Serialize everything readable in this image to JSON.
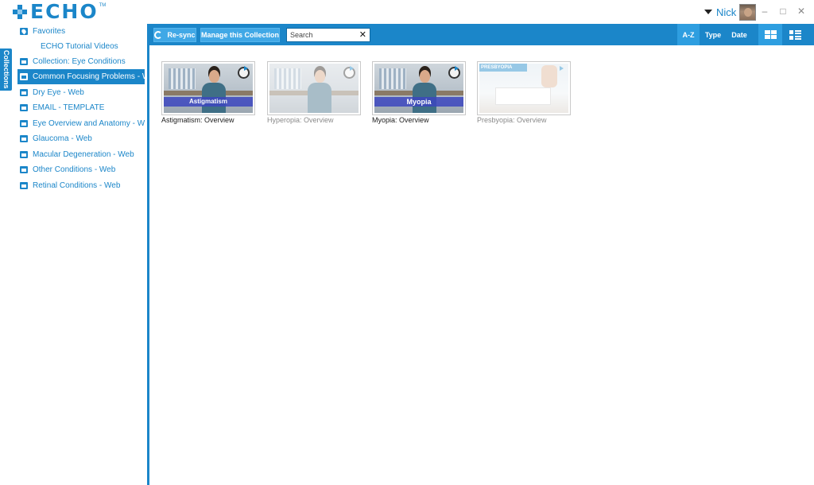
{
  "app": {
    "logo_text": "ECHO",
    "logo_tm": "TM"
  },
  "user": {
    "name": "Nick"
  },
  "window_controls": {
    "minimize": "–",
    "maximize": "□",
    "close": "✕"
  },
  "side_tab": {
    "label": "Collections"
  },
  "sidebar": {
    "items": [
      {
        "label": "Favorites",
        "icon": "heart-icon",
        "selected": false
      },
      {
        "label": "ECHO Tutorial Videos",
        "icon": "",
        "selected": false
      },
      {
        "label": "Collection: Eye Conditions",
        "icon": "collection-icon",
        "selected": false
      },
      {
        "label": "Common Focusing Problems - Web",
        "icon": "folder-open-icon",
        "selected": true
      },
      {
        "label": "Dry Eye - Web",
        "icon": "collection-icon",
        "selected": false
      },
      {
        "label": "EMAIL - TEMPLATE",
        "icon": "collection-icon",
        "selected": false
      },
      {
        "label": "Eye Overview and Anatomy - Web",
        "icon": "collection-icon",
        "selected": false
      },
      {
        "label": "Glaucoma - Web",
        "icon": "collection-icon",
        "selected": false
      },
      {
        "label": "Macular Degeneration - Web",
        "icon": "collection-icon",
        "selected": false
      },
      {
        "label": "Other Conditions - Web",
        "icon": "collection-icon",
        "selected": false
      },
      {
        "label": "Retinal Conditions - Web",
        "icon": "collection-icon",
        "selected": false
      }
    ]
  },
  "toolbar": {
    "resync_label": "Re-sync",
    "manage_label": "Manage this Collection",
    "search_placeholder": "Search",
    "search_value": "",
    "clear_label": "✕",
    "sort_az": "A-Z",
    "sort_type": "Type",
    "sort_date": "Date",
    "active_sort": "A-Z",
    "active_view": "grid"
  },
  "media": [
    {
      "title": "Astigmatism: Overview",
      "banner": "Astigmatism",
      "dimmed": false
    },
    {
      "title": "Hyperopia: Overview",
      "banner": "",
      "dimmed": true
    },
    {
      "title": "Myopia: Overview",
      "banner": "Myopia",
      "dimmed": false
    },
    {
      "title": "Presbyopia: Overview",
      "banner": "PRESBYOPIA",
      "dimmed": true
    }
  ],
  "colors": {
    "brand_blue": "#1b86c9",
    "button_blue": "#40a8e6",
    "active_blue": "#2e9ee0"
  }
}
